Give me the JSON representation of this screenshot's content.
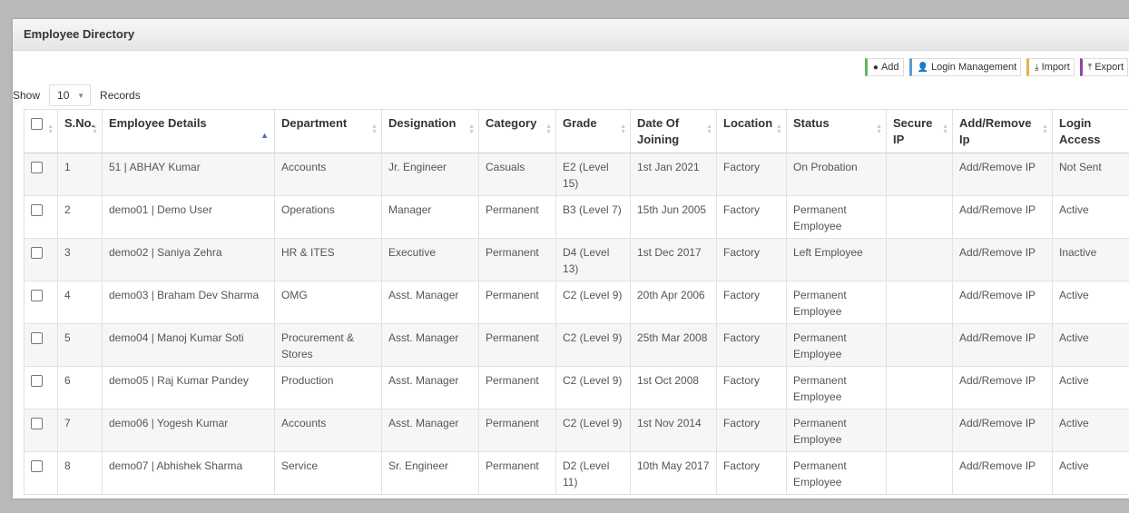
{
  "panel": {
    "title": "Employee Directory"
  },
  "toolbar": {
    "add": "Add",
    "login_management": "Login Management",
    "import": "Import",
    "export": "Export"
  },
  "length_menu": {
    "show": "Show",
    "value": "10",
    "records": "Records"
  },
  "colors": {
    "active": "#3fa34d",
    "inactive": "#d9281b",
    "not_sent": "#f0a23a"
  },
  "columns": [
    "S.No.",
    "Employee Details",
    "Department",
    "Designation",
    "Category",
    "Grade",
    "Date Of Joining",
    "Location",
    "Status",
    "Secure IP",
    "Add/Remove Ip",
    "Login Access"
  ],
  "rows": [
    {
      "sno": "1",
      "employee": "51 | ABHAY  Kumar",
      "department": "Accounts",
      "designation": "Jr. Engineer",
      "category": "Casuals",
      "grade": "E2 (Level 15)",
      "doj": "1st Jan 2021",
      "location": "Factory",
      "status": "On Probation",
      "secure_ip": "",
      "add_remove": "Add/Remove IP",
      "login": "Not Sent",
      "login_state": "orange"
    },
    {
      "sno": "2",
      "employee": "demo01 | Demo User",
      "department": "Operations",
      "designation": "Manager",
      "category": "Permanent",
      "grade": "B3 (Level 7)",
      "doj": "15th Jun 2005",
      "location": "Factory",
      "status": "Permanent Employee",
      "secure_ip": "",
      "add_remove": "Add/Remove IP",
      "login": "Active",
      "login_state": "green"
    },
    {
      "sno": "3",
      "employee": "demo02 | Saniya Zehra",
      "department": "HR & ITES",
      "designation": "Executive",
      "category": "Permanent",
      "grade": "D4 (Level 13)",
      "doj": "1st Dec 2017",
      "location": "Factory",
      "status": "Left Employee",
      "secure_ip": "",
      "add_remove": "Add/Remove IP",
      "login": "Inactive",
      "login_state": "red"
    },
    {
      "sno": "4",
      "employee": "demo03 | Braham Dev Sharma",
      "department": "OMG",
      "designation": "Asst. Manager",
      "category": "Permanent",
      "grade": "C2 (Level 9)",
      "doj": "20th Apr 2006",
      "location": "Factory",
      "status": "Permanent Employee",
      "secure_ip": "",
      "add_remove": "Add/Remove IP",
      "login": "Active",
      "login_state": "green"
    },
    {
      "sno": "5",
      "employee": "demo04 | Manoj Kumar Soti",
      "department": "Procurement & Stores",
      "designation": "Asst. Manager",
      "category": "Permanent",
      "grade": "C2 (Level 9)",
      "doj": "25th Mar 2008",
      "location": "Factory",
      "status": "Permanent Employee",
      "secure_ip": "",
      "add_remove": "Add/Remove IP",
      "login": "Active",
      "login_state": "green"
    },
    {
      "sno": "6",
      "employee": "demo05 | Raj Kumar Pandey",
      "department": "Production",
      "designation": "Asst. Manager",
      "category": "Permanent",
      "grade": "C2 (Level 9)",
      "doj": "1st Oct 2008",
      "location": "Factory",
      "status": "Permanent Employee",
      "secure_ip": "",
      "add_remove": "Add/Remove IP",
      "login": "Active",
      "login_state": "green"
    },
    {
      "sno": "7",
      "employee": "demo06 | Yogesh Kumar",
      "department": "Accounts",
      "designation": "Asst. Manager",
      "category": "Permanent",
      "grade": "C2 (Level 9)",
      "doj": "1st Nov 2014",
      "location": "Factory",
      "status": "Permanent Employee",
      "secure_ip": "",
      "add_remove": "Add/Remove IP",
      "login": "Active",
      "login_state": "green"
    },
    {
      "sno": "8",
      "employee": "demo07 | Abhishek Sharma",
      "department": "Service",
      "designation": "Sr. Engineer",
      "category": "Permanent",
      "grade": "D2 (Level 11)",
      "doj": "10th May 2017",
      "location": "Factory",
      "status": "Permanent Employee",
      "secure_ip": "",
      "add_remove": "Add/Remove IP",
      "login": "Active",
      "login_state": "green"
    }
  ]
}
